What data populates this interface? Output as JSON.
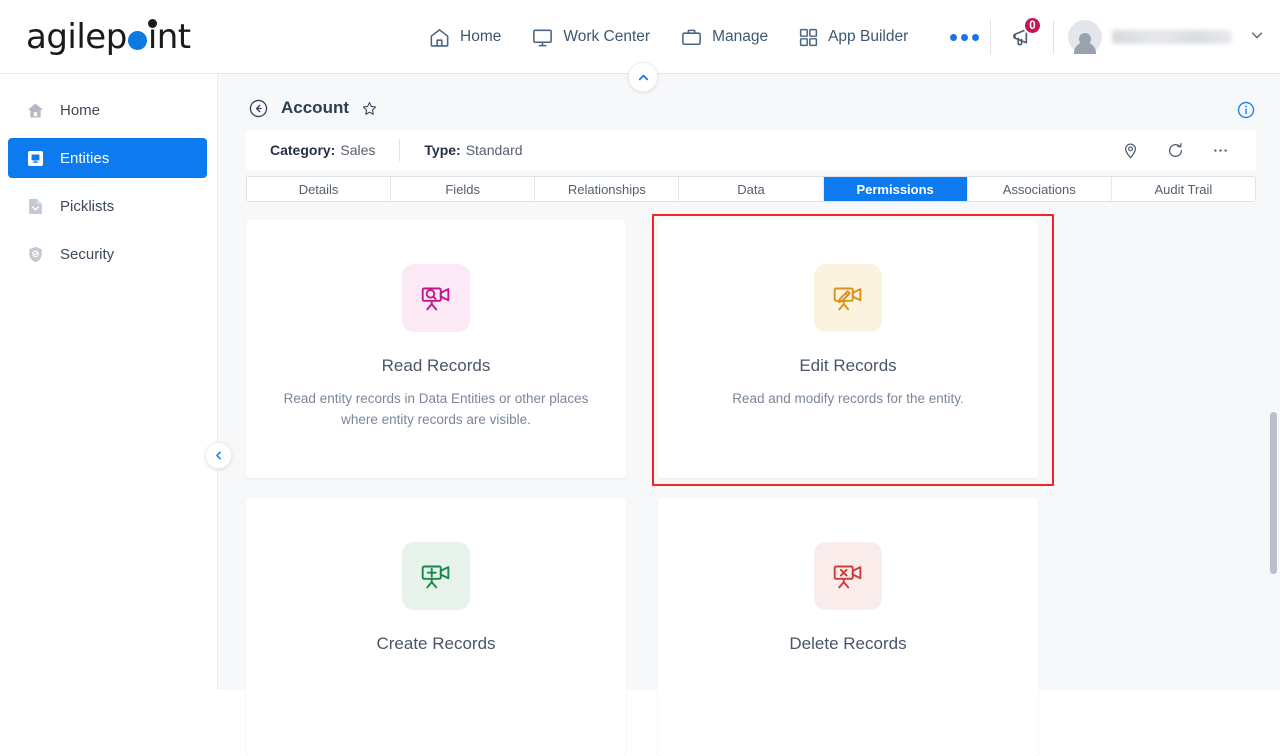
{
  "brand": {
    "name": "agilepoint",
    "accent": "#0c7ae0"
  },
  "topnav": {
    "items": [
      {
        "label": "Home",
        "icon": "home-icon"
      },
      {
        "label": "Work Center",
        "icon": "monitor-icon"
      },
      {
        "label": "Manage",
        "icon": "briefcase-icon"
      },
      {
        "label": "App Builder",
        "icon": "grid-icon"
      }
    ],
    "more_label": "",
    "notifications": {
      "icon": "megaphone-icon",
      "count": "0",
      "badge_color": "#c2185b"
    },
    "user": {
      "avatar": "user-avatar-icon",
      "name": "",
      "chevron": "chevron-down-icon"
    }
  },
  "sidebar": {
    "items": [
      {
        "label": "Home",
        "icon": "home-icon",
        "active": false
      },
      {
        "label": "Entities",
        "icon": "entity-icon",
        "active": true
      },
      {
        "label": "Picklists",
        "icon": "picklist-icon",
        "active": false
      },
      {
        "label": "Security",
        "icon": "shield-icon",
        "active": false
      }
    ],
    "collapse_icon": "chevron-left-icon",
    "active_color": "#0d7bef"
  },
  "page": {
    "back_icon": "back-arrow-icon",
    "title": "Account",
    "favorite_icon": "star-icon",
    "info_icon": "info-icon",
    "collapse_icon": "chevron-up-icon"
  },
  "meta": {
    "category_label": "Category:",
    "category_value": "Sales",
    "type_label": "Type:",
    "type_value": "Standard",
    "actions": [
      {
        "icon": "location-pin-icon"
      },
      {
        "icon": "refresh-icon"
      },
      {
        "icon": "more-ellipsis-icon"
      }
    ]
  },
  "tabs": [
    {
      "label": "Details",
      "active": false
    },
    {
      "label": "Fields",
      "active": false
    },
    {
      "label": "Relationships",
      "active": false
    },
    {
      "label": "Data",
      "active": false
    },
    {
      "label": "Permissions",
      "active": true
    },
    {
      "label": "Associations",
      "active": false
    },
    {
      "label": "Audit Trail",
      "active": false
    }
  ],
  "permission_cards": [
    {
      "title": "Read Records",
      "description": "Read entity records in Data Entities or other places where entity records are visible.",
      "icon": "camera-search-icon",
      "icon_color": "#c2188a",
      "icon_bg": "#fbe9f5",
      "highlighted": false
    },
    {
      "title": "Edit Records",
      "description": "Read and modify records for the entity.",
      "icon": "camera-pencil-icon",
      "icon_color": "#d9921b",
      "icon_bg": "#fcf2e0",
      "highlighted": true
    },
    {
      "title": "Create Records",
      "description": "",
      "icon": "camera-plus-icon",
      "icon_color": "#19874a",
      "icon_bg": "#e7f3ea",
      "highlighted": false
    },
    {
      "title": "Delete Records",
      "description": "",
      "icon": "camera-x-icon",
      "icon_color": "#cc3c3c",
      "icon_bg": "#fbecec",
      "highlighted": false
    }
  ],
  "highlight": {
    "color": "#f0262b"
  },
  "scrollbar": {
    "present": true
  }
}
